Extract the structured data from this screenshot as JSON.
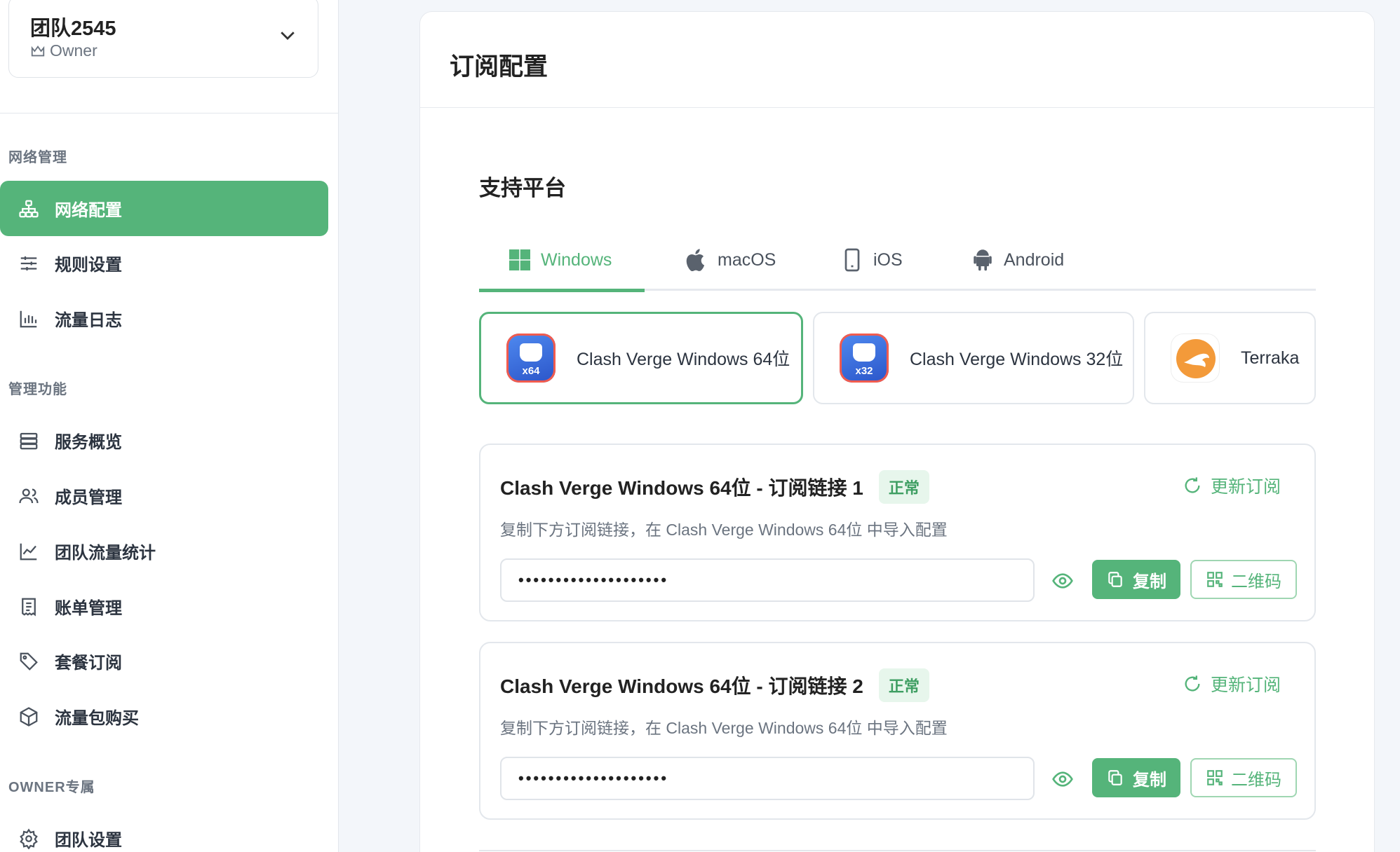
{
  "team": {
    "name": "团队2545",
    "role": "Owner"
  },
  "sidebar": {
    "sections": [
      {
        "title": "网络管理"
      },
      {
        "title": "管理功能"
      },
      {
        "title": "OWNER专属"
      }
    ],
    "items": [
      {
        "label": "网络配置",
        "icon": "network-icon"
      },
      {
        "label": "规则设置",
        "icon": "sliders-icon"
      },
      {
        "label": "流量日志",
        "icon": "bar-chart-icon"
      },
      {
        "label": "服务概览",
        "icon": "server-icon"
      },
      {
        "label": "成员管理",
        "icon": "users-icon"
      },
      {
        "label": "团队流量统计",
        "icon": "line-chart-icon"
      },
      {
        "label": "账单管理",
        "icon": "receipt-icon"
      },
      {
        "label": "套餐订阅",
        "icon": "tag-icon"
      },
      {
        "label": "流量包购买",
        "icon": "box-icon"
      },
      {
        "label": "团队设置",
        "icon": "gear-icon"
      }
    ],
    "active_item": "网络配置"
  },
  "main": {
    "title": "订阅配置",
    "platforms_title": "支持平台",
    "tabs": [
      {
        "label": "Windows",
        "icon": "windows-icon"
      },
      {
        "label": "macOS",
        "icon": "apple-icon"
      },
      {
        "label": "iOS",
        "icon": "phone-icon"
      },
      {
        "label": "Android",
        "icon": "android-icon"
      }
    ],
    "active_tab": "Windows",
    "clients": [
      {
        "label": "Clash Verge Windows 64位",
        "badge": "x64"
      },
      {
        "label": "Clash Verge Windows 32位",
        "badge": "x32"
      },
      {
        "label": "Terraka"
      }
    ],
    "selected_client": "Clash Verge Windows 64位",
    "subscriptions": [
      {
        "title": "Clash Verge Windows 64位 - 订阅链接 1",
        "status": "正常",
        "refresh_label": "更新订阅",
        "description": "复制下方订阅链接，在 Clash Verge Windows 64位 中导入配置",
        "masked_link": "••••••••••••••••••••",
        "copy_label": "复制",
        "qr_label": "二维码"
      },
      {
        "title": "Clash Verge Windows 64位 - 订阅链接 2",
        "status": "正常",
        "refresh_label": "更新订阅",
        "description": "复制下方订阅链接，在 Clash Verge Windows 64位 中导入配置",
        "masked_link": "••••••••••••••••••••",
        "copy_label": "复制",
        "qr_label": "二维码"
      }
    ]
  },
  "colors": {
    "accent": "#55b47a",
    "badge_bg": "#e7f6ec",
    "page_bg": "#f3f6fa"
  }
}
